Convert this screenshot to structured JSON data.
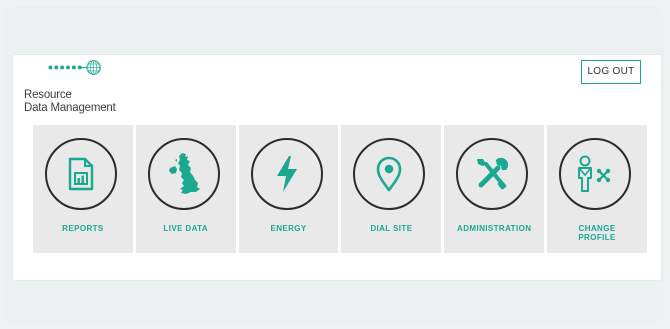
{
  "brand": {
    "name_line1": "Resource",
    "name_line2": "Data Management",
    "accent": "#1aa890",
    "icon": "globe-icon"
  },
  "header": {
    "logout_label": "LOG OUT"
  },
  "tiles": [
    {
      "label": "REPORTS",
      "icon": "report-document-icon"
    },
    {
      "label": "LIVE DATA",
      "icon": "uk-map-icon"
    },
    {
      "label": "ENERGY",
      "icon": "lightning-bolt-icon"
    },
    {
      "label": "DIAL SITE",
      "icon": "map-pin-icon"
    },
    {
      "label": "ADMINISTRATION",
      "icon": "wrench-screwdriver-icon"
    },
    {
      "label_line1": "CHANGE",
      "label_line2": "PROFILE",
      "icon": "user-swap-icon"
    }
  ]
}
